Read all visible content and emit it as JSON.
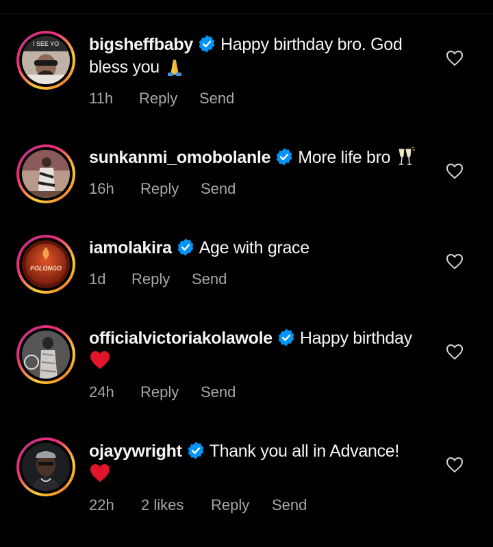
{
  "comments": [
    {
      "username": "bigsheffbaby",
      "text": "Happy birthday bro. God bless you",
      "emoji": "folded-hands",
      "time": "11h",
      "likes": "",
      "reply": "Reply",
      "send": "Send",
      "avatar_caption": "I SEE YO"
    },
    {
      "username": "sunkanmi_omobolanle",
      "text": "More life bro",
      "emoji": "clinking-glasses",
      "time": "16h",
      "likes": "",
      "reply": "Reply",
      "send": "Send"
    },
    {
      "username": "iamolakira",
      "text": "Age with grace",
      "emoji": "",
      "time": "1d",
      "likes": "",
      "reply": "Reply",
      "send": "Send",
      "avatar_caption": "POLONGO"
    },
    {
      "username": "officialvictoriakolawole",
      "text": "Happy birthday",
      "emoji": "red-heart",
      "time": "24h",
      "likes": "",
      "reply": "Reply",
      "send": "Send"
    },
    {
      "username": "ojayywright",
      "text": "Thank you all in Advance!",
      "emoji": "red-heart",
      "time": "22h",
      "likes": "2 likes",
      "reply": "Reply",
      "send": "Send"
    }
  ],
  "colors": {
    "background": "#000000",
    "text": "#f5f5f5",
    "secondary": "#a8a8a8",
    "verified": "#0095f6",
    "heart": "#e0152c"
  }
}
